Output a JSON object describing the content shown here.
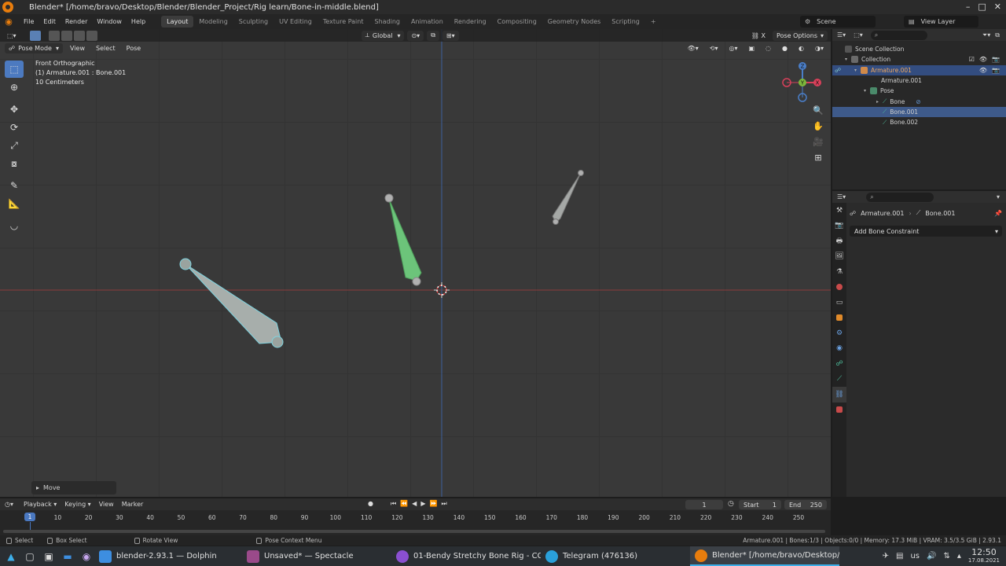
{
  "window": {
    "title": "Blender* [/home/bravo/Desktop/Blender/Blender_Project/Rig learn/Bone-in-middle.blend]",
    "controls": [
      "–",
      "□",
      "✕"
    ]
  },
  "menu": [
    "File",
    "Edit",
    "Render",
    "Window",
    "Help"
  ],
  "workspaces": [
    "Layout",
    "Modeling",
    "Sculpting",
    "UV Editing",
    "Texture Paint",
    "Shading",
    "Animation",
    "Rendering",
    "Compositing",
    "Geometry Nodes",
    "Scripting"
  ],
  "active_workspace": "Layout",
  "scene_name": "Scene",
  "view_layer": "View Layer",
  "viewport": {
    "header": {
      "transform_orientation": "Global",
      "pose_options": "Pose Options"
    },
    "header2": {
      "mode": "Pose Mode",
      "menus": [
        "View",
        "Select",
        "Pose"
      ]
    },
    "overlay": {
      "view_name": "Front Orthographic",
      "active": "(1) Armature.001 : Bone.001",
      "scale": "10 Centimeters"
    },
    "gizmo": {
      "x": "X",
      "y": "Y",
      "z": "Z"
    },
    "last_op": "Move"
  },
  "outliner": {
    "rows": [
      {
        "label": "Scene Collection"
      },
      {
        "label": "Collection"
      },
      {
        "label": "Armature.001"
      },
      {
        "label": "Armature.001"
      },
      {
        "label": "Pose"
      },
      {
        "label": "Bone"
      },
      {
        "label": "Bone.001"
      },
      {
        "label": "Bone.002"
      }
    ]
  },
  "properties": {
    "breadcrumb_object": "Armature.001",
    "breadcrumb_bone": "Bone.001",
    "add_constraint": "Add Bone Constraint"
  },
  "timeline": {
    "menus": [
      "Playback",
      "Keying",
      "View",
      "Marker"
    ],
    "current_frame": "1",
    "start_label": "Start",
    "start": "1",
    "end_label": "End",
    "end": "250",
    "ticks": [
      "10",
      "20",
      "30",
      "40",
      "50",
      "60",
      "70",
      "80",
      "90",
      "100",
      "110",
      "120",
      "130",
      "140",
      "150",
      "160",
      "170",
      "180",
      "190",
      "200",
      "210",
      "220",
      "230",
      "240",
      "250"
    ]
  },
  "statusbar": {
    "select": "Select",
    "box_select": "Box Select",
    "rotate_view": "Rotate View",
    "context_menu": "Pose Context Menu",
    "stats": "Armature.001 | Bones:1/3 | Objects:0/0 | Memory: 17.3 MiB | VRAM: 3.5/3.5 GiB | 2.93.1"
  },
  "taskbar": {
    "tasks": [
      {
        "label": "blender-2.93.1 — Dolphin",
        "color": "#3d8ee0"
      },
      {
        "label": "Unsaved* — Spectacle",
        "color": "#9a4a8a"
      },
      {
        "label": "01-Bendy Stretchy Bone Rig - CG C...",
        "color": "#8a4fd0"
      },
      {
        "label": "Telegram (476136)",
        "color": "#2aa0da"
      },
      {
        "label": "Blender* [/home/bravo/Desktop/B...",
        "color": "#e87d0d"
      }
    ],
    "keyboard": "us",
    "time": "12:50",
    "date": "17.08.2021"
  }
}
